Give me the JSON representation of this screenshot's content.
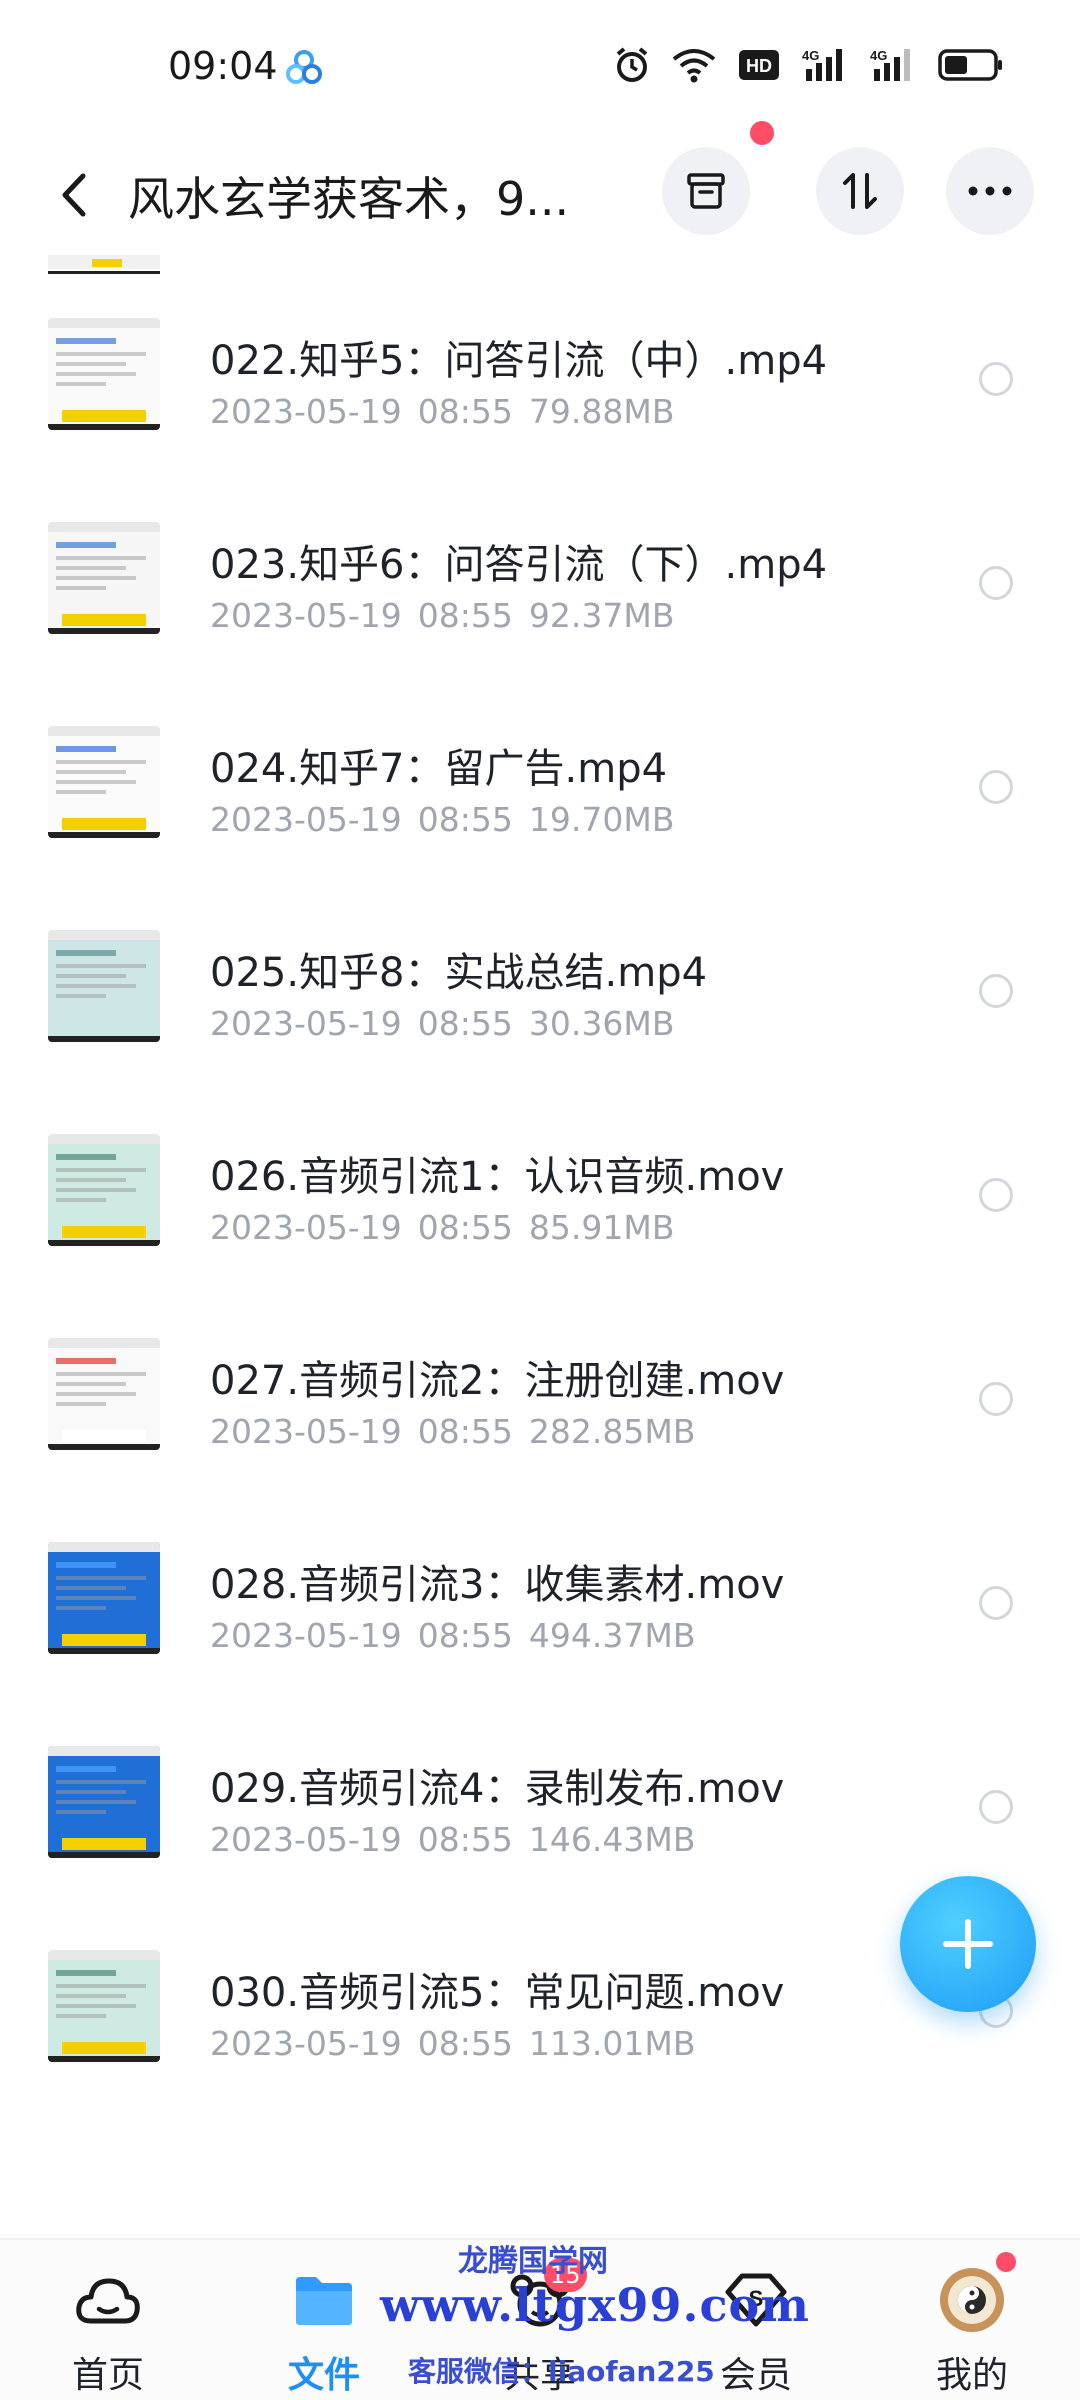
{
  "status_bar": {
    "time": "09:04",
    "icons": [
      "alarm-icon",
      "wifi-icon",
      "hd-icon",
      "signal-4g-icon",
      "signal-4g-icon",
      "battery-icon"
    ],
    "hd_label": "HD",
    "network_label": "4G"
  },
  "header": {
    "title": "风水玄学获客术，9...",
    "actions": [
      "archive-icon",
      "sort-icon",
      "more-icon"
    ]
  },
  "files": [
    {
      "name": "022.知乎5：问答引流（中）.mp4",
      "date": "2023-05-19",
      "time": "08:55",
      "size": "79.88MB"
    },
    {
      "name": "023.知乎6：问答引流（下）.mp4",
      "date": "2023-05-19",
      "time": "08:55",
      "size": "92.37MB"
    },
    {
      "name": "024.知乎7：留广告.mp4",
      "date": "2023-05-19",
      "time": "08:55",
      "size": "19.70MB"
    },
    {
      "name": "025.知乎8：实战总结.mp4",
      "date": "2023-05-19",
      "time": "08:55",
      "size": "30.36MB"
    },
    {
      "name": "026.音频引流1：认识音频.mov",
      "date": "2023-05-19",
      "time": "08:55",
      "size": "85.91MB"
    },
    {
      "name": "027.音频引流2：注册创建.mov",
      "date": "2023-05-19",
      "time": "08:55",
      "size": "282.85MB"
    },
    {
      "name": "028.音频引流3：收集素材.mov",
      "date": "2023-05-19",
      "time": "08:55",
      "size": "494.37MB"
    },
    {
      "name": "029.音频引流4：录制发布.mov",
      "date": "2023-05-19",
      "time": "08:55",
      "size": "146.43MB"
    },
    {
      "name": "030.音频引流5：常见问题.mov",
      "date": "2023-05-19",
      "time": "08:55",
      "size": "113.01MB"
    }
  ],
  "fab": {
    "icon": "plus-icon"
  },
  "nav": {
    "items": [
      {
        "label": "首页",
        "icon": "cloud-icon"
      },
      {
        "label": "文件",
        "icon": "folder-icon",
        "active": true
      },
      {
        "label": "共享",
        "icon": "share-icon",
        "badge": "15"
      },
      {
        "label": "会员",
        "icon": "vip-icon"
      },
      {
        "label": "我的",
        "icon": "avatar-icon"
      }
    ]
  },
  "watermark": {
    "line1": "龙腾国学网",
    "line2": "www.ltgx99.com",
    "line3": "客服微信：liaofan225"
  },
  "colors": {
    "accent": "#1e8ff5",
    "badge": "#ff4d67",
    "meta_text": "#a1a5ad"
  }
}
